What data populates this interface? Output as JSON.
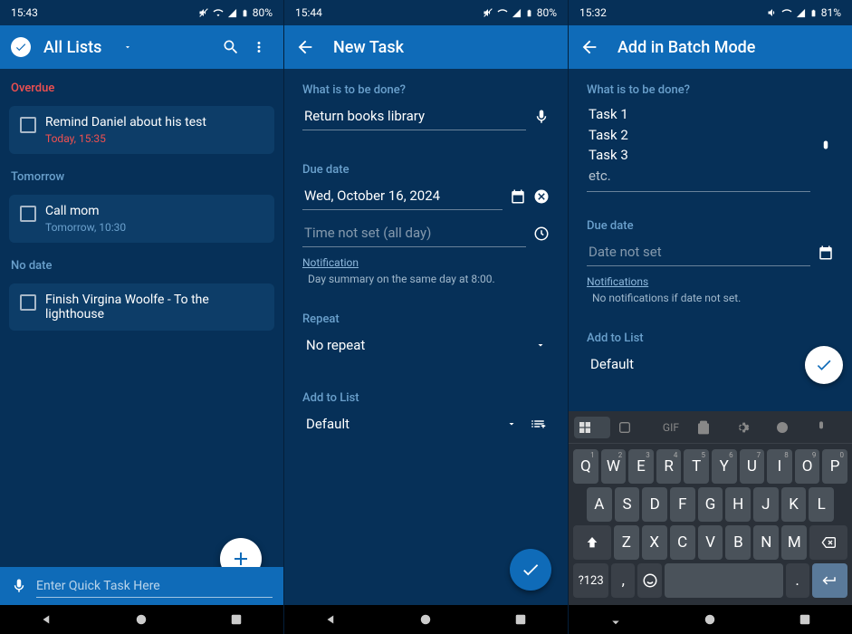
{
  "panel1": {
    "status": {
      "time": "15:43",
      "battery": "80%"
    },
    "appbar": {
      "title": "All Lists"
    },
    "sections": {
      "overdue": {
        "label": "Overdue",
        "task_title": "Remind Daniel about his test",
        "task_sub": "Today, 15:35"
      },
      "tomorrow": {
        "label": "Tomorrow",
        "task_title": "Call mom",
        "task_sub": "Tomorrow, 10:30"
      },
      "nodate": {
        "label": "No date",
        "task_title": "Finish Virgina Woolfe - To the lighthouse"
      }
    },
    "quick_task_placeholder": "Enter Quick Task Here"
  },
  "panel2": {
    "status": {
      "time": "15:44",
      "battery": "80%"
    },
    "appbar": {
      "title": "New Task"
    },
    "what_label": "What is to be done?",
    "what_value": "Return books library",
    "due_label": "Due date",
    "due_value": "Wed, October 16, 2024",
    "time_placeholder": "Time not set (all day)",
    "notif_link": "Notification",
    "notif_sub": "Day summary on the same day at 8:00.",
    "repeat_label": "Repeat",
    "repeat_value": "No repeat",
    "list_label": "Add to List",
    "list_value": "Default"
  },
  "panel3": {
    "status": {
      "time": "15:32",
      "battery": "81%"
    },
    "appbar": {
      "title": "Add in Batch Mode"
    },
    "what_label": "What is to be done?",
    "lines": [
      "Task 1",
      "Task 2",
      "Task 3"
    ],
    "etc": "etc.",
    "due_label": "Due date",
    "due_placeholder": "Date not set",
    "notif_link": "Notifications",
    "notif_sub": "No notifications if date not set.",
    "list_label": "Add to List",
    "list_value": "Default",
    "keyboard": {
      "row1": [
        "Q",
        "W",
        "E",
        "R",
        "T",
        "Y",
        "U",
        "I",
        "O",
        "P"
      ],
      "row1_hints": [
        "1",
        "2",
        "3",
        "4",
        "5",
        "6",
        "7",
        "8",
        "9",
        "0"
      ],
      "row2": [
        "A",
        "S",
        "D",
        "F",
        "G",
        "H",
        "J",
        "K",
        "L"
      ],
      "row3": [
        "Z",
        "X",
        "C",
        "V",
        "B",
        "N",
        "M"
      ],
      "symbol": "?123",
      "comma": ",",
      "period": ".",
      "gif": "GIF"
    }
  }
}
